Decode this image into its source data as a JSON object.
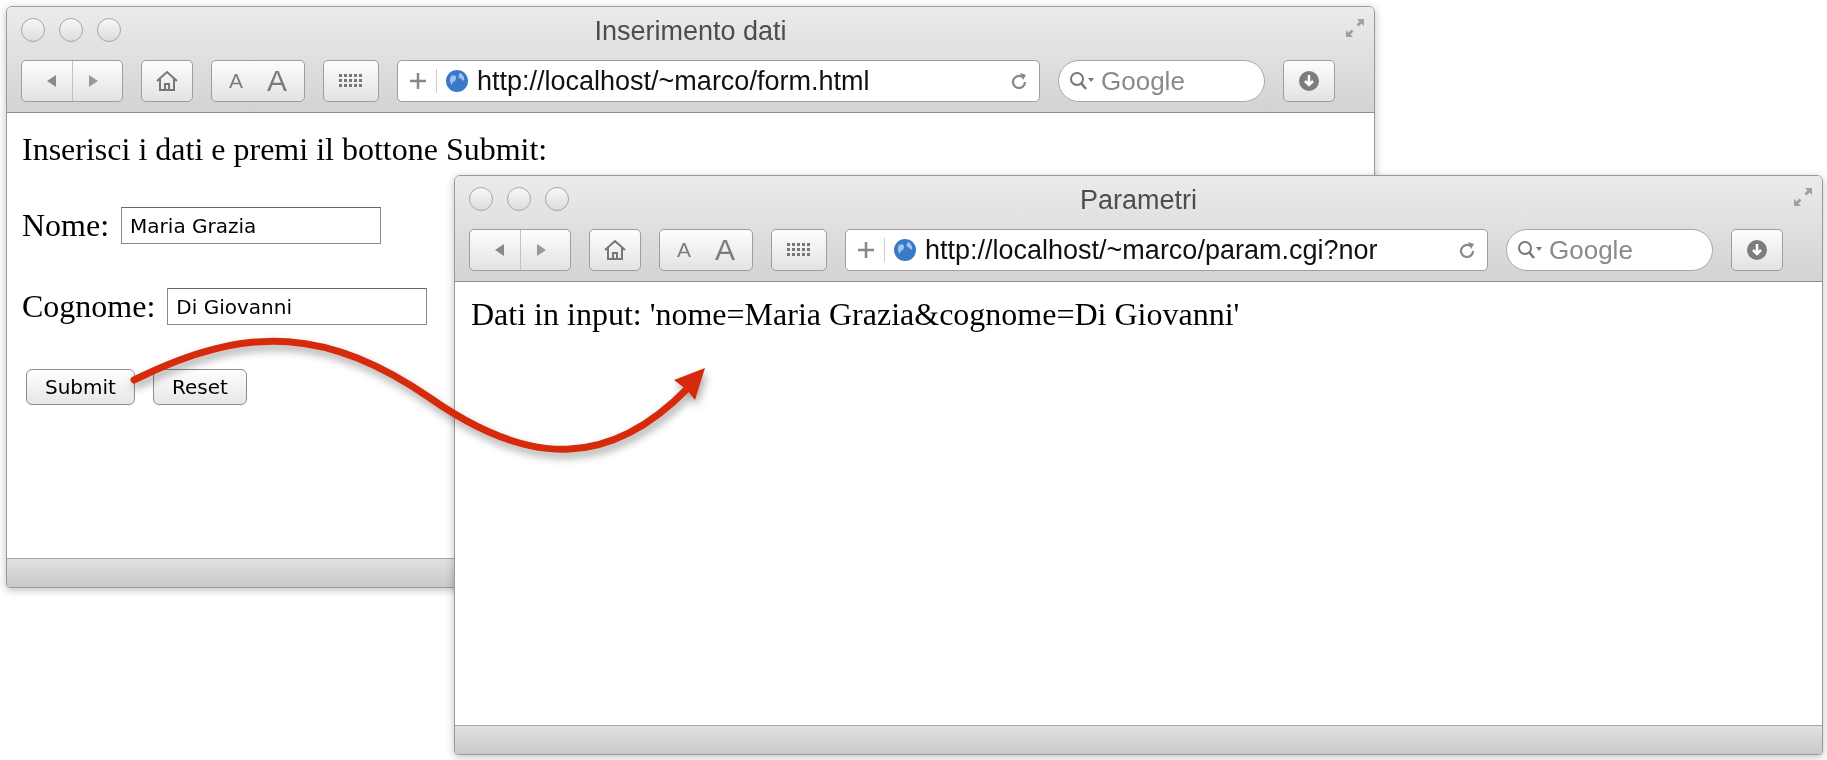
{
  "windows": [
    {
      "kind": "form",
      "title": "Inserimento dati",
      "url": "http://localhost/~marco/form.html",
      "text_size_buttons": [
        "A",
        "A"
      ],
      "search": {
        "placeholder": "Google"
      },
      "intro": "Inserisci i dati e premi il bottone Submit:",
      "fields": [
        {
          "label": "Nome:",
          "value": "Maria Grazia"
        },
        {
          "label": "Cognome:",
          "value": "Di Giovanni"
        }
      ],
      "buttons": [
        "Submit",
        "Reset"
      ]
    },
    {
      "kind": "output",
      "title": "Parametri",
      "url": "http://localhost/~marco/param.cgi?nor",
      "text_size_buttons": [
        "A",
        "A"
      ],
      "search": {
        "placeholder": "Google"
      },
      "text": "Dati in input: 'nome=Maria Grazia&cognome=Di Giovanni'"
    }
  ]
}
